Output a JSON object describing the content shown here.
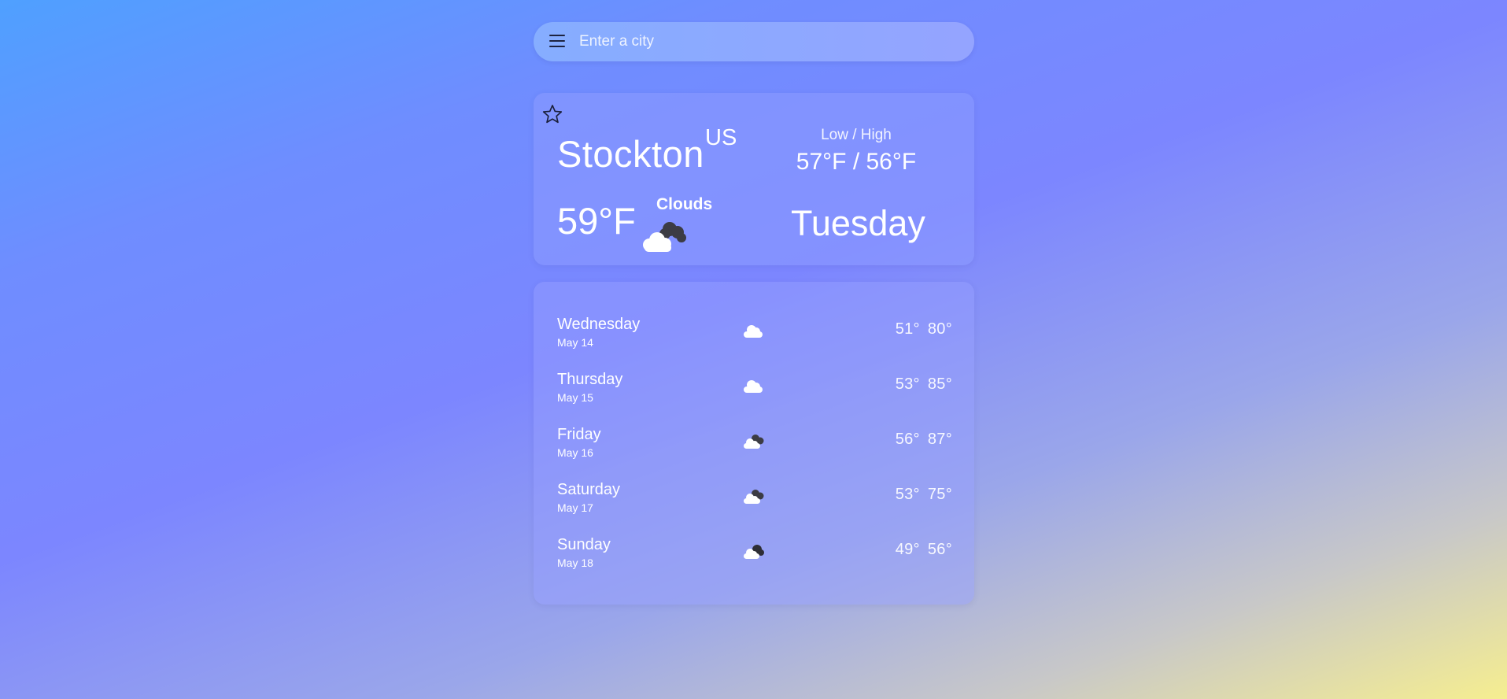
{
  "search": {
    "placeholder": "Enter a city"
  },
  "current": {
    "city": "Stockton",
    "country": "US",
    "low_high_label": "Low / High",
    "low_high_value": "57°F / 56°F",
    "temp": "59°F",
    "condition": "Clouds",
    "condition_icon": "broken-clouds-icon",
    "day": "Tuesday"
  },
  "forecast": [
    {
      "day": "Wednesday",
      "date": "May 14",
      "icon": "few-clouds-icon",
      "low": "51°",
      "high": "80°"
    },
    {
      "day": "Thursday",
      "date": "May 15",
      "icon": "few-clouds-icon",
      "low": "53°",
      "high": "85°"
    },
    {
      "day": "Friday",
      "date": "May 16",
      "icon": "broken-clouds-icon",
      "low": "56°",
      "high": "87°"
    },
    {
      "day": "Saturday",
      "date": "May 17",
      "icon": "broken-clouds-icon",
      "low": "53°",
      "high": "75°"
    },
    {
      "day": "Sunday",
      "date": "May 18",
      "icon": "overcast-clouds-icon",
      "low": "49°",
      "high": "56°"
    }
  ]
}
